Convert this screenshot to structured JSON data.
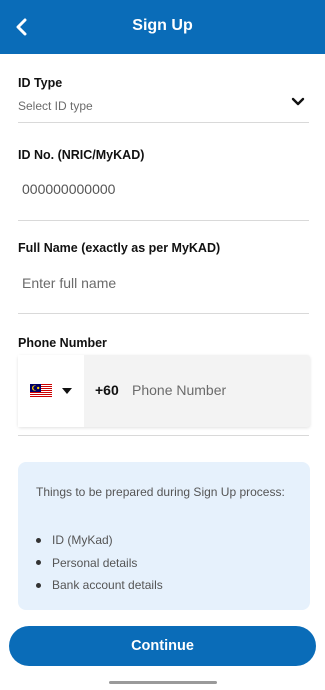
{
  "header": {
    "title": "Sign Up",
    "back_icon": "chevron-left-icon"
  },
  "id_type": {
    "label": "ID Type",
    "placeholder": "Select ID type",
    "dropdown_icon": "chevron-down-icon"
  },
  "id_no": {
    "label": "ID No. (NRIC/MyKAD)",
    "value": "000000000000"
  },
  "full_name": {
    "label": "Full Name (exactly as per MyKAD)",
    "placeholder": "Enter full name"
  },
  "phone": {
    "label": "Phone Number",
    "country_flag": "malaysia-flag-icon",
    "dial_code": "+60",
    "placeholder": "Phone Number"
  },
  "info_box": {
    "heading": "Things to be prepared during Sign Up process:",
    "items": [
      "ID (MyKad)",
      "Personal details",
      "Bank account details"
    ]
  },
  "footer": {
    "continue_label": "Continue"
  },
  "colors": {
    "primary": "#0a6cb8",
    "info_background": "#e6f1fc"
  }
}
